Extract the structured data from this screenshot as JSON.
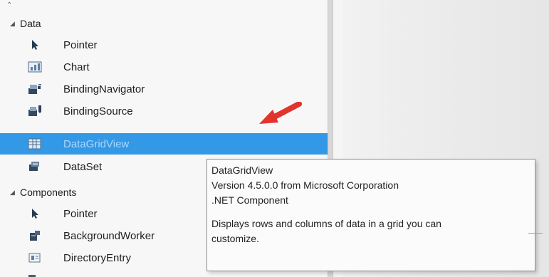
{
  "toolbox": {
    "top_caret": "⌃",
    "data_category": "Data",
    "components_category": "Components",
    "data_items": [
      {
        "label": "Pointer",
        "icon": "pointer-icon"
      },
      {
        "label": "Chart",
        "icon": "chart-icon"
      },
      {
        "label": "BindingNavigator",
        "icon": "binding-navigator-icon"
      },
      {
        "label": "BindingSource",
        "icon": "binding-source-icon"
      },
      {
        "label": "DataGridView",
        "icon": "datagridview-icon",
        "selected": true
      },
      {
        "label": "DataSet",
        "icon": "dataset-icon"
      }
    ],
    "components_items": [
      {
        "label": "Pointer",
        "icon": "pointer-icon"
      },
      {
        "label": "BackgroundWorker",
        "icon": "background-worker-icon"
      },
      {
        "label": "DirectoryEntry",
        "icon": "directory-entry-icon"
      }
    ]
  },
  "tooltip": {
    "title": "DataGridView",
    "version": "Version 4.5.0.0 from Microsoft Corporation",
    "component_type": ".NET Component",
    "description_line_1": "Displays rows and columns of data in a grid you can",
    "description_line_2": "customize."
  },
  "colors": {
    "selection_background": "#3399e6",
    "annotation_arrow": "#e0342d",
    "tooltip_border": "#8f8f8f"
  }
}
